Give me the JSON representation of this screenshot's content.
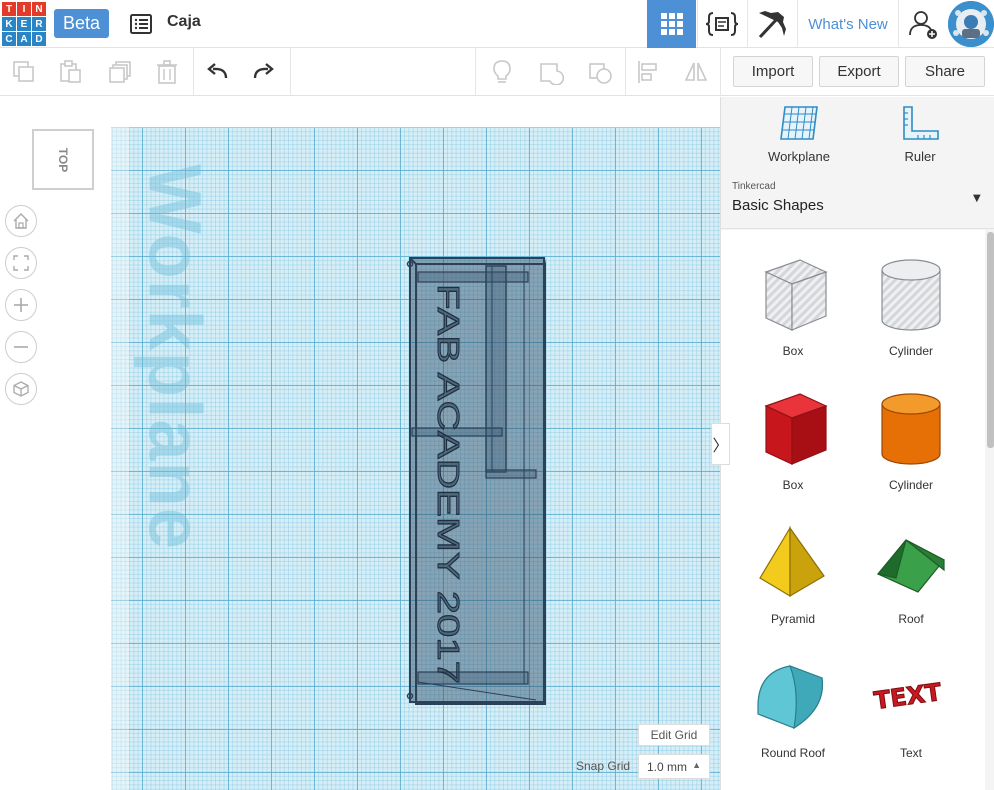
{
  "app": {
    "logo_letters": [
      "T",
      "I",
      "N",
      "K",
      "E",
      "R",
      "C",
      "A",
      "D"
    ],
    "logo_colors": [
      "#e23b2a",
      "#e23b2a",
      "#e23b2a",
      "#2985c6",
      "#2985c6",
      "#2985c6",
      "#2985c6",
      "#2985c6",
      "#2985c6"
    ],
    "beta_label": "Beta",
    "design_title": "Caja",
    "whats_new": "What's New",
    "accent": "#4d90d6"
  },
  "topbar": {
    "buttons": [
      "design-list-icon",
      "3d-view-grid-icon",
      "codeblocks-icon",
      "minecraft-pickaxe-icon",
      "add-user-icon"
    ]
  },
  "toolbar": {
    "import_label": "Import",
    "export_label": "Export",
    "share_label": "Share"
  },
  "viewcube": {
    "face_label": "TOP"
  },
  "workplane": {
    "label": "Workplane",
    "model_text": "FAB ACADEMY 2017",
    "edit_grid_label": "Edit Grid",
    "snap_grid_label": "Snap Grid",
    "snap_grid_value": "1.0 mm"
  },
  "panel": {
    "workplane_label": "Workplane",
    "ruler_label": "Ruler",
    "library_source": "Tinkercad",
    "library_name": "Basic Shapes",
    "shapes": [
      {
        "label": "Box"
      },
      {
        "label": "Cylinder"
      },
      {
        "label": "Box"
      },
      {
        "label": "Cylinder"
      },
      {
        "label": "Pyramid"
      },
      {
        "label": "Roof"
      },
      {
        "label": "Round Roof"
      },
      {
        "label": "Text"
      }
    ],
    "text_shape_glyphs": "TEXT"
  }
}
